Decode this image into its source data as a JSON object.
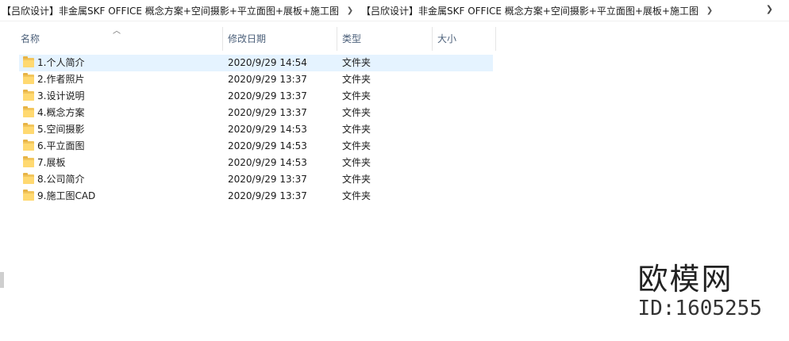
{
  "breadcrumb": {
    "items": [
      "【吕欣设计】非金属SKF OFFICE  概念方案+空间摄影+平立面图+展板+施工图",
      "【吕欣设计】非金属SKF OFFICE  概念方案+空间摄影+平立面图+展板+施工图"
    ]
  },
  "columns": {
    "name": "名称",
    "date": "修改日期",
    "type": "类型",
    "size": "大小"
  },
  "files": [
    {
      "name": "1.个人简介",
      "date": "2020/9/29 14:54",
      "type": "文件夹",
      "selected": true
    },
    {
      "name": "2.作者照片",
      "date": "2020/9/29 13:37",
      "type": "文件夹"
    },
    {
      "name": "3.设计说明",
      "date": "2020/9/29 13:37",
      "type": "文件夹"
    },
    {
      "name": "4.概念方案",
      "date": "2020/9/29 13:37",
      "type": "文件夹"
    },
    {
      "name": "5.空间摄影",
      "date": "2020/9/29 14:53",
      "type": "文件夹"
    },
    {
      "name": "6.平立面图",
      "date": "2020/9/29 14:53",
      "type": "文件夹"
    },
    {
      "name": "7.展板",
      "date": "2020/9/29 14:53",
      "type": "文件夹"
    },
    {
      "name": "8.公司简介",
      "date": "2020/9/29 13:37",
      "type": "文件夹"
    },
    {
      "name": "9.施工图CAD",
      "date": "2020/9/29 13:37",
      "type": "文件夹"
    }
  ],
  "watermark": {
    "title": "欧模网",
    "id": "ID:1605255"
  }
}
